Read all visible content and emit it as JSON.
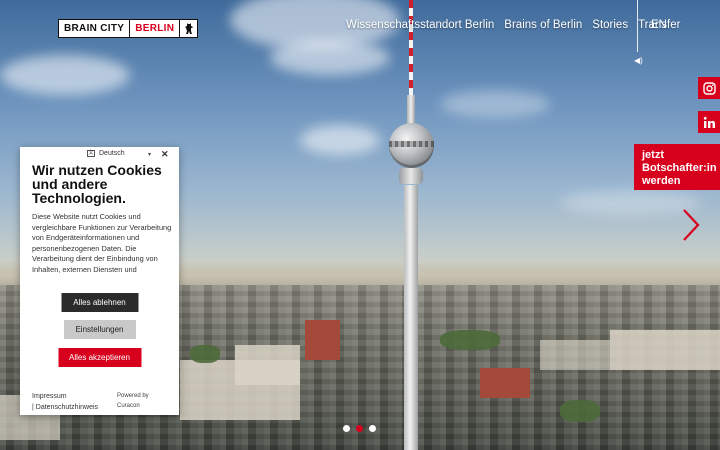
{
  "header": {
    "logo": {
      "brain": "BRAIN CITY",
      "berlin": "BERLIN"
    },
    "nav": [
      "Wissenschaftsstandort Berlin",
      "Brains of Berlin",
      "Stories",
      "Transfer"
    ],
    "language": "EN"
  },
  "sidebar_right": {
    "cta_line1": "jetzt",
    "cta_line2": "Botschafter:in",
    "cta_line3": "werden"
  },
  "slider": {
    "count": 3,
    "active_index": 1
  },
  "cookie_banner": {
    "language": "Deutsch",
    "title": "Wir nutzen Cookies und andere Technologien.",
    "body": "Diese Website nutzt Cookies und vergleichbare Funktionen zur Verarbeitung von Endgeräteinformationen und personenbezogenen Daten. Die Verarbeitung dient der Einbindung von Inhalten, externen Diensten und",
    "decline": "Alles ablehnen",
    "settings": "Einstellungen",
    "accept": "Alles akzeptieren",
    "imprint": "Impressum",
    "privacy": "| Datenschutzhinweis",
    "powered_by": "Powered by",
    "powered_name": "Curacon"
  },
  "colors": {
    "brand_red": "#d7001d",
    "dark_button": "#2b2b2b",
    "light_button": "#c9c9c9"
  },
  "icons": [
    "bear-icon",
    "sound-icon",
    "instagram-icon",
    "linkedin-icon",
    "chevron-right-icon",
    "close-icon",
    "flag-icon"
  ]
}
